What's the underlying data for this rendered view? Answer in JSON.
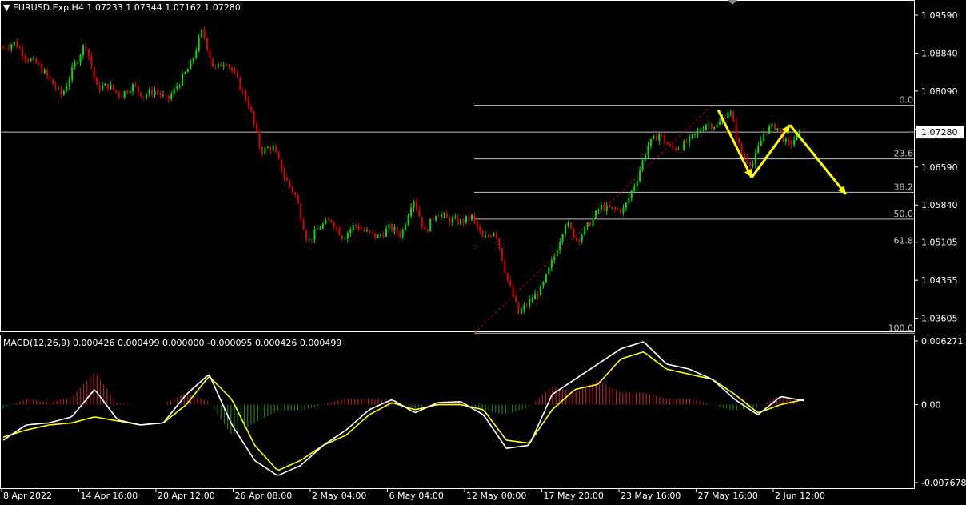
{
  "header": {
    "symbol_line": "EURUSD.Exp,H4  1.07233 1.07344 1.07162 1.07280",
    "macd_line": "MACD(12,26,9) 0.000426 0.000499 0.000000 -0.000095 0.000426 0.000499"
  },
  "colors": {
    "background": "#000000",
    "bull": "#00e000",
    "bear": "#e00000",
    "macd_line": "#ffffff",
    "signal_line": "#ffff00",
    "hist_pos": "#b02020",
    "hist_neg": "#1e7a1e",
    "fib": "#c0c0c0",
    "arrow": "#ffff00",
    "axis": "#ffffff",
    "price_line": "#c0c0c0"
  },
  "chart_data": [
    {
      "type": "candlestick",
      "ylim": [
        1.0333,
        1.0989
      ],
      "y_ticks": [
        "1.09590",
        "1.08840",
        "1.08090",
        "1.07340",
        "1.06590",
        "1.05840",
        "1.05105",
        "1.04355",
        "1.03605"
      ],
      "current_price": "1.07280",
      "x_ticks": [
        "8 Apr 2022",
        "14 Apr 16:00",
        "20 Apr 12:00",
        "26 Apr 08:00",
        "2 May 04:00",
        "6 May 04:00",
        "12 May 00:00",
        "17 May 20:00",
        "23 May 16:00",
        "27 May 16:00",
        "2 Jun 12:00"
      ],
      "close_path": [
        1.0895,
        1.0905,
        1.0875,
        1.086,
        1.083,
        1.08,
        1.0855,
        1.0905,
        1.0815,
        1.082,
        1.08,
        1.082,
        1.08,
        1.081,
        1.079,
        1.0825,
        1.086,
        1.093,
        1.085,
        1.087,
        1.083,
        1.078,
        1.069,
        1.07,
        1.064,
        1.06,
        1.051,
        1.054,
        1.0555,
        1.052,
        1.0545,
        1.053,
        1.052,
        1.054,
        1.0525,
        1.06,
        1.053,
        1.057,
        1.0555,
        1.055,
        1.056,
        1.0515,
        1.0535,
        1.044,
        1.037,
        1.0395,
        1.042,
        1.048,
        1.055,
        1.0515,
        1.0545,
        1.058,
        1.0575,
        1.0575,
        1.063,
        1.07,
        1.0725,
        1.0695,
        1.07,
        1.072,
        1.0745,
        1.074,
        1.0775,
        1.0685,
        1.0665,
        1.073,
        1.074,
        1.07,
        1.0725
      ],
      "fibonacci": {
        "levels": [
          {
            "label": "0.0",
            "price": 1.0781
          },
          {
            "label": "23.6",
            "price": 1.0675
          },
          {
            "label": "38.2",
            "price": 1.0609
          },
          {
            "label": "50.0",
            "price": 1.0556
          },
          {
            "label": "61.8",
            "price": 1.0503
          },
          {
            "label": "100.0",
            "price": 1.0331
          }
        ]
      },
      "projection_path": [
        {
          "x": "27 May 16:00",
          "y": 1.0772
        },
        {
          "x": "29 May",
          "y": 1.0638
        },
        {
          "x": "1 Jun",
          "y": 1.0742
        },
        {
          "x": "5 Jun",
          "y": 1.0605
        }
      ]
    },
    {
      "type": "line",
      "title": "MACD(12,26,9)",
      "ylim": [
        -0.007678,
        0.006271
      ],
      "y_ticks": [
        "0.006271",
        "0.00",
        "-0.007678"
      ],
      "series": [
        {
          "name": "MACD",
          "values": [
            -0.0035,
            -0.002,
            -0.0018,
            -0.0012,
            0.0015,
            -0.0015,
            -0.002,
            -0.0018,
            0.001,
            0.003,
            -0.002,
            -0.0055,
            -0.007,
            -0.006,
            -0.004,
            -0.0025,
            -0.0005,
            0.0005,
            -0.0008,
            0.0002,
            0.0003,
            -0.001,
            -0.0043,
            -0.004,
            0.001,
            0.0025,
            0.004,
            0.0055,
            0.0062,
            0.004,
            0.0035,
            0.0025,
            0.0005,
            -0.001,
            0.0008,
            0.0004
          ]
        },
        {
          "name": "Signal",
          "values": [
            -0.0032,
            -0.0025,
            -0.002,
            -0.0018,
            -0.0012,
            -0.0016,
            -0.002,
            -0.0018,
            0.0,
            0.0028,
            0.0005,
            -0.004,
            -0.0065,
            -0.0055,
            -0.004,
            -0.003,
            -0.001,
            0.0002,
            -0.0005,
            0.0,
            0.0,
            -0.0005,
            -0.0035,
            -0.0038,
            -0.0005,
            0.0015,
            0.002,
            0.0045,
            0.0052,
            0.0035,
            0.003,
            0.0025,
            0.001,
            -0.0008,
            0.0,
            0.0005
          ]
        }
      ]
    }
  ]
}
